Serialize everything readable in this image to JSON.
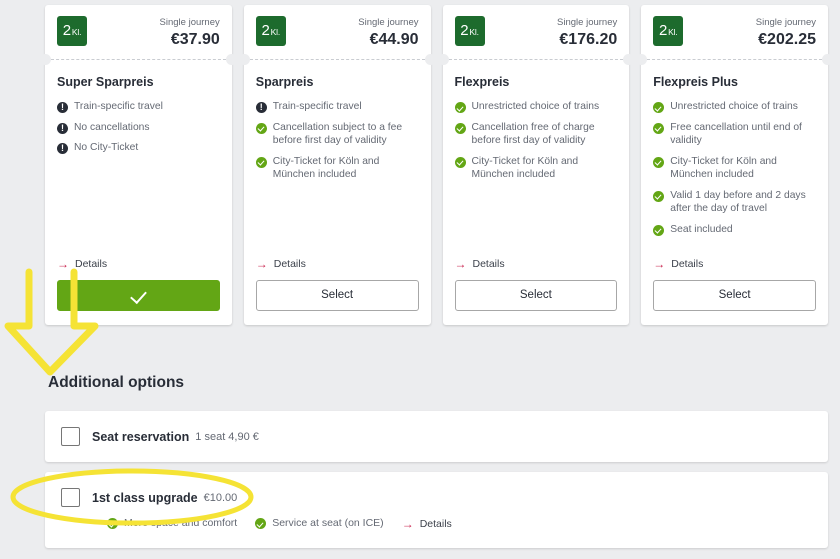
{
  "fares": [
    {
      "journey_type": "Single journey",
      "price": "€37.90",
      "class_badge": "2",
      "class_badge_suffix": "Kl.",
      "name": "Super Sparpreis",
      "features": [
        {
          "type": "neg",
          "text": "Train-specific travel"
        },
        {
          "type": "neg",
          "text": "No cancellations"
        },
        {
          "type": "neg",
          "text": "No City-Ticket"
        }
      ],
      "details_label": "Details",
      "button_label": "",
      "selected": true
    },
    {
      "journey_type": "Single journey",
      "price": "€44.90",
      "class_badge": "2",
      "class_badge_suffix": "Kl.",
      "name": "Sparpreis",
      "features": [
        {
          "type": "neg",
          "text": "Train-specific travel"
        },
        {
          "type": "pos",
          "text": "Cancellation subject to a fee before first day of validity"
        },
        {
          "type": "pos",
          "text": "City-Ticket for Köln and München included"
        }
      ],
      "details_label": "Details",
      "button_label": "Select",
      "selected": false
    },
    {
      "journey_type": "Single journey",
      "price": "€176.20",
      "class_badge": "2",
      "class_badge_suffix": "Kl.",
      "name": "Flexpreis",
      "features": [
        {
          "type": "pos",
          "text": "Unrestricted choice of trains"
        },
        {
          "type": "pos",
          "text": "Cancellation free of charge before first day of validity"
        },
        {
          "type": "pos",
          "text": "City-Ticket for Köln and München included"
        }
      ],
      "details_label": "Details",
      "button_label": "Select",
      "selected": false
    },
    {
      "journey_type": "Single journey",
      "price": "€202.25",
      "class_badge": "2",
      "class_badge_suffix": "Kl.",
      "name": "Flexpreis Plus",
      "features": [
        {
          "type": "pos",
          "text": "Unrestricted choice of trains"
        },
        {
          "type": "pos",
          "text": "Free cancellation until end of validity"
        },
        {
          "type": "pos",
          "text": "City-Ticket for Köln and München included"
        },
        {
          "type": "pos",
          "text": "Valid 1 day before and 2 days after the day of travel"
        },
        {
          "type": "pos",
          "text": "Seat included"
        }
      ],
      "details_label": "Details",
      "button_label": "Select",
      "selected": false
    }
  ],
  "additional_options": {
    "title": "Additional options",
    "items": [
      {
        "label": "Seat reservation",
        "sub": "1 seat 4,90 €",
        "checked": false,
        "features": []
      },
      {
        "label": "1st class upgrade",
        "sub": "€10.00",
        "checked": false,
        "features": [
          {
            "type": "pos",
            "text": "More space and comfort"
          },
          {
            "type": "pos",
            "text": "Service at seat (on ICE)"
          }
        ],
        "details_label": "Details"
      }
    ]
  },
  "annotations": {
    "arrow_color": "#f5e335",
    "ellipse_color": "#f5e335",
    "arrow_name": "down-arrow-annotation",
    "ellipse_name": "ellipse-highlight-annotation"
  },
  "colors": {
    "accent_green": "#63a615",
    "badge_green": "#1d6b2d",
    "link_red": "#c9214c",
    "page_background": "#ecedef"
  }
}
